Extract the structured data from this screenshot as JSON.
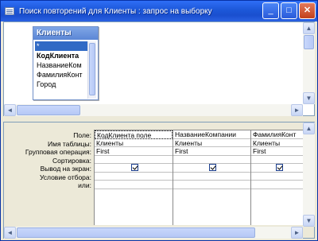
{
  "window": {
    "title": "Поиск повторений для Клиенты : запрос на выборку",
    "controls": {
      "minimize": "_",
      "maximize": "□",
      "close": "✕"
    }
  },
  "table_box": {
    "title": "Клиенты",
    "fields": [
      "*",
      "КодКлиента",
      "НазваниеКом",
      "ФамилияКонт",
      "Город"
    ]
  },
  "grid": {
    "row_labels": [
      "Поле:",
      "Имя таблицы:",
      "Групповая операция:",
      "Сортировка:",
      "Вывод на экран:",
      "Условие отбора:",
      "или:"
    ],
    "columns": [
      {
        "field": "КодКлиента поле",
        "table": "Клиенты",
        "group": "First",
        "sort": "",
        "show": true,
        "criteria": "",
        "or": ""
      },
      {
        "field": "НазваниеКомпании",
        "table": "Клиенты",
        "group": "First",
        "sort": "",
        "show": true,
        "criteria": "",
        "or": ""
      },
      {
        "field": "ФамилияКонт",
        "table": "Клиенты",
        "group": "First",
        "sort": "",
        "show": true,
        "criteria": "",
        "or": ""
      }
    ]
  },
  "icons": {
    "app": "query-window-icon",
    "scroll_up": "▲",
    "scroll_down": "▼",
    "scroll_left": "◄",
    "scroll_right": "►"
  }
}
